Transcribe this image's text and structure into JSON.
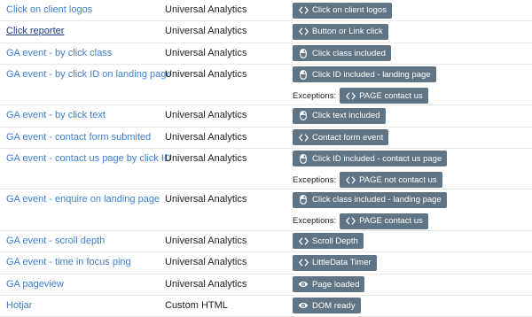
{
  "tags": [
    {
      "name": "Click on client logos",
      "type": "Universal Analytics",
      "triggers": [
        {
          "icon": "code-icon",
          "label": "Click on client logos"
        }
      ],
      "exceptions": []
    },
    {
      "name": "Click reporter",
      "type": "Universal Analytics",
      "visited": true,
      "triggers": [
        {
          "icon": "code-icon",
          "label": "Button or Link click"
        }
      ],
      "exceptions": []
    },
    {
      "name": "GA event - by click class",
      "type": "Universal Analytics",
      "triggers": [
        {
          "icon": "mouse-icon",
          "label": "Click class included"
        }
      ],
      "exceptions": []
    },
    {
      "name": "GA event - by click ID on landing page",
      "type": "Universal Analytics",
      "triggers": [
        {
          "icon": "mouse-icon",
          "label": "Click ID included - landing page"
        }
      ],
      "exceptions_label": "Exceptions:",
      "exceptions": [
        {
          "icon": "code-icon",
          "label": "PAGE contact us"
        }
      ]
    },
    {
      "name": "GA event - by click text",
      "type": "Universal Analytics",
      "triggers": [
        {
          "icon": "mouse-icon",
          "label": "Click text included"
        }
      ],
      "exceptions": []
    },
    {
      "name": "GA event - contact form submited",
      "type": "Universal Analytics",
      "triggers": [
        {
          "icon": "code-icon",
          "label": "Contact form event"
        }
      ],
      "exceptions": []
    },
    {
      "name": "GA event - contact us page by click ID",
      "type": "Universal Analytics",
      "triggers": [
        {
          "icon": "mouse-icon",
          "label": "Click ID included - contact us page"
        }
      ],
      "exceptions_label": "Exceptions:",
      "exceptions": [
        {
          "icon": "code-icon",
          "label": "PAGE not contact us"
        }
      ]
    },
    {
      "name": "GA event - enquire on landing page",
      "type": "Universal Analytics",
      "triggers": [
        {
          "icon": "mouse-icon",
          "label": "Click class included - landing page"
        }
      ],
      "exceptions_label": "Exceptions:",
      "exceptions": [
        {
          "icon": "code-icon",
          "label": "PAGE contact us"
        }
      ]
    },
    {
      "name": "GA event - scroll depth",
      "type": "Universal Analytics",
      "triggers": [
        {
          "icon": "code-icon",
          "label": "Scroll Depth"
        }
      ],
      "exceptions": []
    },
    {
      "name": "GA event - time in focus ping",
      "type": "Universal Analytics",
      "triggers": [
        {
          "icon": "code-icon",
          "label": "LittleData Timer"
        }
      ],
      "exceptions": []
    },
    {
      "name": "GA pageview",
      "type": "Universal Analytics",
      "triggers": [
        {
          "icon": "eye-icon",
          "label": "Page loaded"
        }
      ],
      "exceptions": []
    },
    {
      "name": "Hotjar",
      "type": "Custom HTML",
      "triggers": [
        {
          "icon": "eye-icon",
          "label": "DOM ready"
        }
      ],
      "exceptions": []
    }
  ]
}
